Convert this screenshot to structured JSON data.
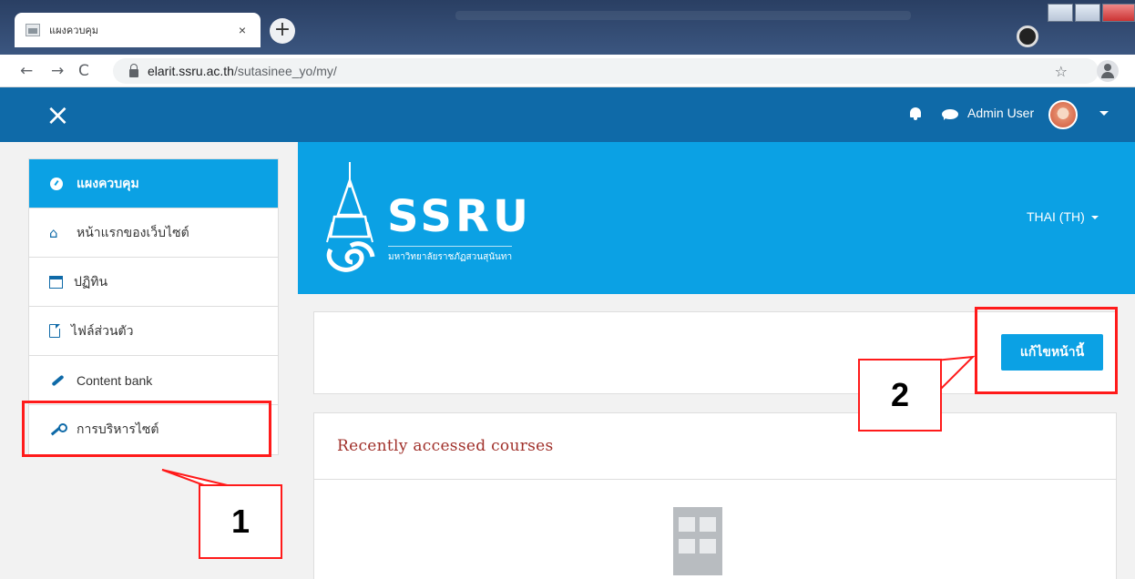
{
  "browser": {
    "tab_title": "แผงควบคุม",
    "tab_close": "×",
    "new_tab": "+",
    "url_host": "elarit.ssru.ac.th",
    "url_path": "/sutasinee_yo/my/",
    "nav_back": "←",
    "nav_forward": "→",
    "nav_reload": "C",
    "bookmark": "☆"
  },
  "navbar": {
    "close_icon": "×",
    "user_name": "Admin User"
  },
  "sidebar": {
    "items": [
      {
        "label": "แผงควบคุม",
        "icon": "dashboard-icon",
        "active": true
      },
      {
        "label": "หน้าแรกของเว็บไซต์",
        "icon": "home-icon"
      },
      {
        "label": "ปฏิทิน",
        "icon": "calendar-icon"
      },
      {
        "label": "ไฟล์ส่วนตัว",
        "icon": "file-icon"
      },
      {
        "label": "Content bank",
        "icon": "paintbrush-icon"
      },
      {
        "label": "การบริหารไซต์",
        "icon": "wrench-icon"
      }
    ]
  },
  "header": {
    "logo_text": "SSRU",
    "logo_subtext": "มหาวิทยาลัยราชภัฏสวนสุนันทา",
    "language": "THAI (TH)"
  },
  "main": {
    "edit_button": "แก้ไขหน้านี้",
    "recent_title": "Recently accessed courses"
  },
  "annotations": {
    "step1": "1",
    "step2": "2",
    "color": "#ff1a1a"
  },
  "colors": {
    "navbar": "#0f6aa8",
    "accent": "#0ba1e4",
    "heading": "#a0302a"
  }
}
